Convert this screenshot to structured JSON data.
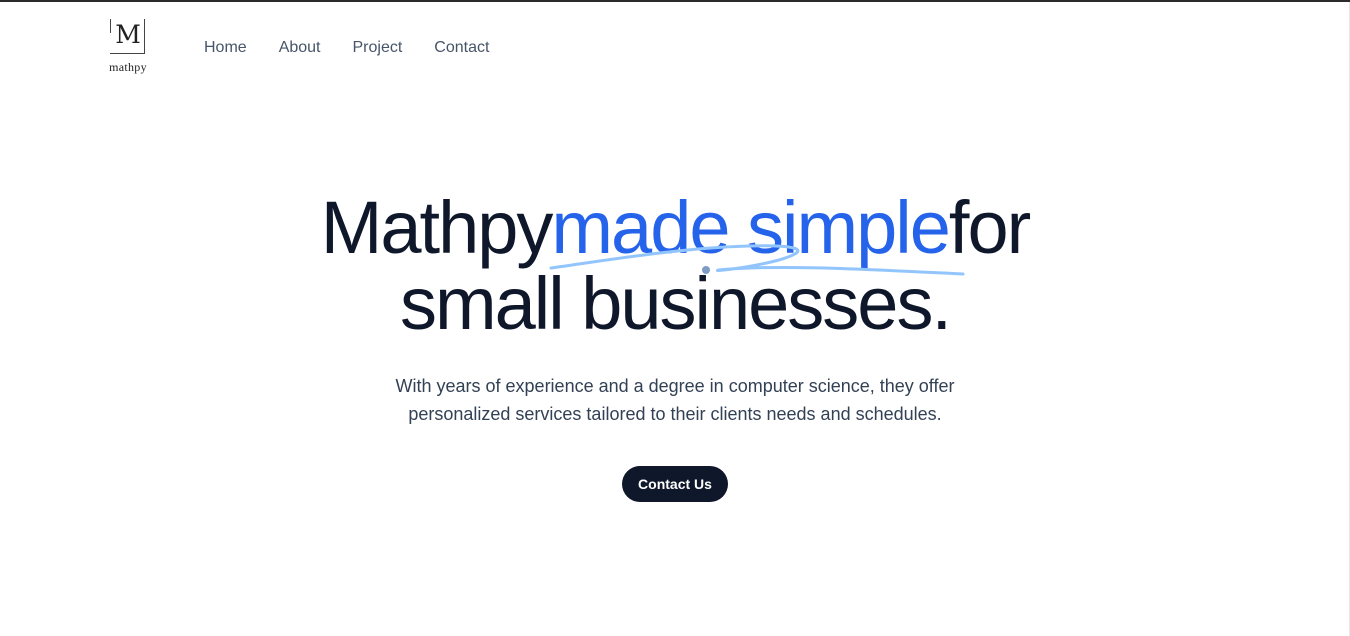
{
  "header": {
    "logo": {
      "letter": "M",
      "wordmark": "mathpy"
    },
    "nav": [
      {
        "label": "Home"
      },
      {
        "label": "About"
      },
      {
        "label": "Project"
      },
      {
        "label": "Contact"
      }
    ]
  },
  "hero": {
    "headline_start": "Mathpy",
    "headline_accent": "made simple",
    "headline_end_line1": "for",
    "headline_line2": "small businesses.",
    "subtext_line1": "With years of experience and a degree in computer science, they offer",
    "subtext_line2": "personalized services tailored to their clients needs and schedules.",
    "cta_label": "Contact Us"
  },
  "colors": {
    "accent": "#2563eb",
    "text_dark": "#0f172a",
    "nav_text": "#475569",
    "scribble": "#93c5fd"
  }
}
